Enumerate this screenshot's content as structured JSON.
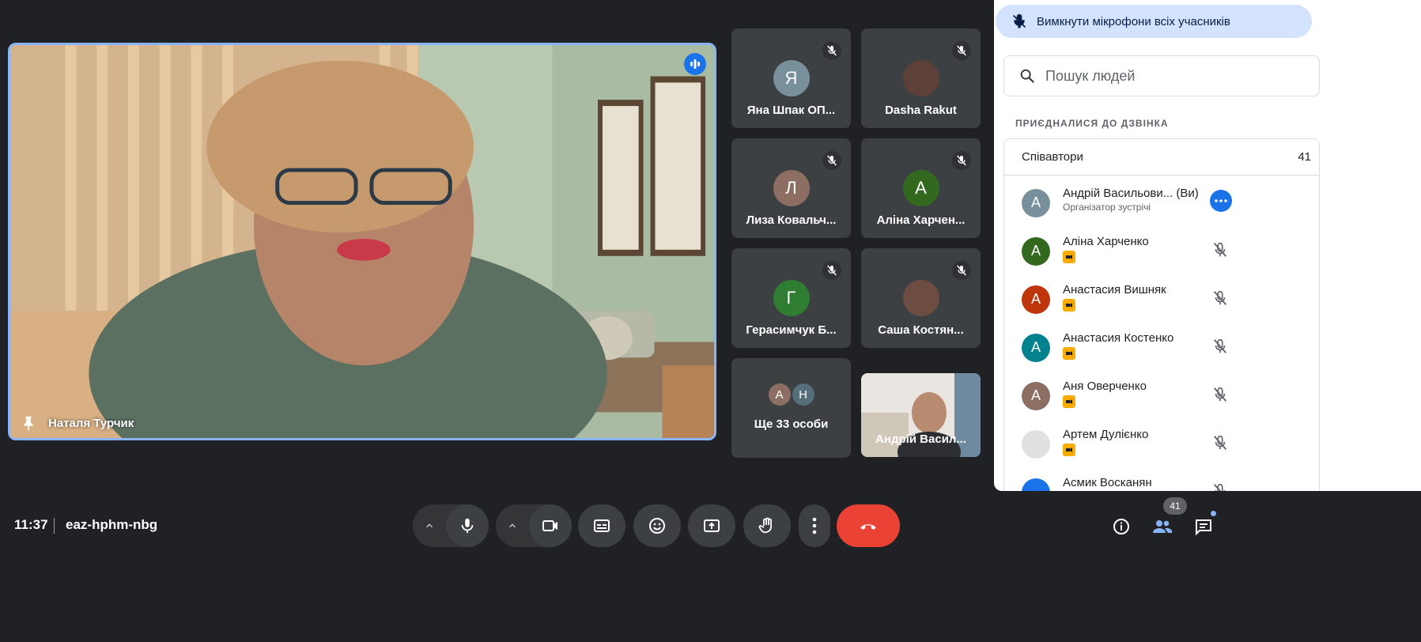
{
  "main_video": {
    "name": "Наталя Турчик"
  },
  "tiles": [
    {
      "initial": "Я",
      "name": "Яна Шпак ОП...",
      "color": "#78909c"
    },
    {
      "initial": "",
      "name": "Dasha Rakut",
      "color": "#5d4037"
    },
    {
      "initial": "Л",
      "name": "Лиза Ковальч...",
      "color": "#8d6e63"
    },
    {
      "initial": "А",
      "name": "Аліна Харчен...",
      "color": "#33691e"
    },
    {
      "initial": "Г",
      "name": "Герасимчук Б...",
      "color": "#2e7d32"
    },
    {
      "initial": "",
      "name": "Саша Костян...",
      "color": "#6d4c41"
    }
  ],
  "more_tile": {
    "label": "Ще 33 особи",
    "avatars": [
      {
        "initial": "А",
        "color": "#8d6e63"
      },
      {
        "initial": "Н",
        "color": "#546e7a"
      }
    ]
  },
  "self_tile": {
    "name": "Андрій Васил..."
  },
  "panel": {
    "mute_all": "Вимкнути мікрофони всіх учасників",
    "search_placeholder": "Пошук людей",
    "section": "ПРИЄДНАЛИСЯ ДО ДЗВІНКА",
    "group_name": "Співавтори",
    "group_count": "41",
    "people": [
      {
        "initial": "А",
        "name": "Андрій Васильови...  (Ви)",
        "sub": "Організатор зустрічі",
        "color": "#78909c",
        "host": true
      },
      {
        "initial": "А",
        "name": "Аліна Харченко",
        "sub": "",
        "color": "#33691e",
        "host": false
      },
      {
        "initial": "А",
        "name": "Анастасия Вишняк",
        "sub": "",
        "color": "#bf360c",
        "host": false
      },
      {
        "initial": "А",
        "name": "Анастасия Костенко",
        "sub": "",
        "color": "#00838f",
        "host": false
      },
      {
        "initial": "А",
        "name": "Аня Оверченко",
        "sub": "",
        "color": "#8d6e63",
        "host": false
      },
      {
        "initial": "",
        "name": "Артем Дулієнко",
        "sub": "",
        "color": "#e0e0e0",
        "host": false
      },
      {
        "initial": "",
        "name": "Асмик Восканян",
        "sub": "",
        "color": "#1a73e8",
        "host": false
      }
    ]
  },
  "bottom": {
    "time": "11:37",
    "meeting_code": "eaz-hphm-nbg",
    "people_count": "41"
  }
}
